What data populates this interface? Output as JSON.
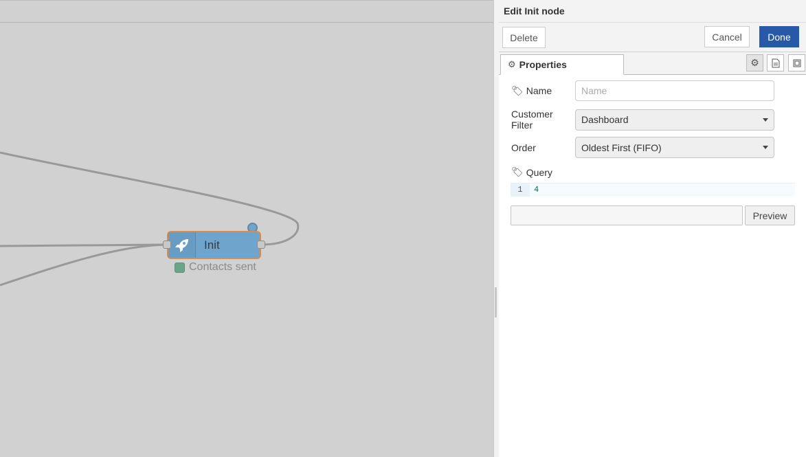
{
  "canvas": {
    "node": {
      "label": "Init",
      "icon": "rocket-icon"
    },
    "status": {
      "text": "Contacts sent",
      "color": "#6aa489"
    }
  },
  "tray": {
    "title": "Edit Init node",
    "buttons": {
      "delete": "Delete",
      "cancel": "Cancel",
      "done": "Done"
    },
    "tabs": {
      "properties": "Properties"
    },
    "form": {
      "name": {
        "label": "Name",
        "value": "",
        "placeholder": "Name"
      },
      "customer_filter": {
        "label": "Customer Filter",
        "selected": "Dashboard"
      },
      "order": {
        "label": "Order",
        "selected": "Oldest First (FIFO)"
      },
      "query": {
        "label": "Query",
        "line_number": "1",
        "code": "4"
      }
    },
    "preview": {
      "button": "Preview",
      "value": ""
    }
  },
  "colors": {
    "accent": "#2759a6",
    "node_fill": "#6fa5cd",
    "node_border": "#e08a47"
  }
}
